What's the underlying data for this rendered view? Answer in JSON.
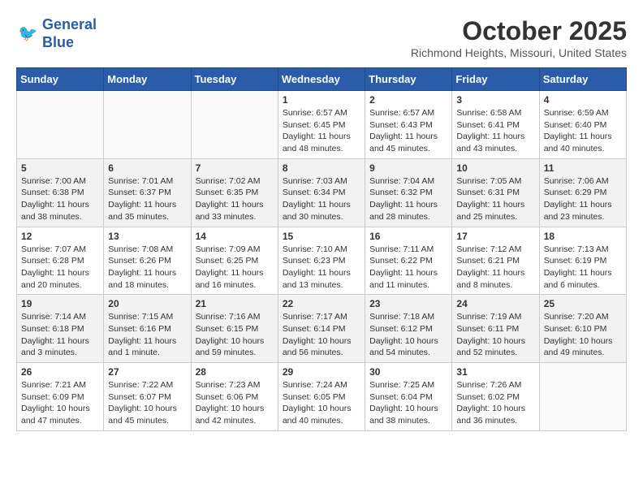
{
  "header": {
    "logo_line1": "General",
    "logo_line2": "Blue",
    "month_year": "October 2025",
    "location": "Richmond Heights, Missouri, United States"
  },
  "days_of_week": [
    "Sunday",
    "Monday",
    "Tuesday",
    "Wednesday",
    "Thursday",
    "Friday",
    "Saturday"
  ],
  "weeks": [
    {
      "shade": "white",
      "days": [
        {
          "num": "",
          "info": ""
        },
        {
          "num": "",
          "info": ""
        },
        {
          "num": "",
          "info": ""
        },
        {
          "num": "1",
          "info": "Sunrise: 6:57 AM\nSunset: 6:45 PM\nDaylight: 11 hours\nand 48 minutes."
        },
        {
          "num": "2",
          "info": "Sunrise: 6:57 AM\nSunset: 6:43 PM\nDaylight: 11 hours\nand 45 minutes."
        },
        {
          "num": "3",
          "info": "Sunrise: 6:58 AM\nSunset: 6:41 PM\nDaylight: 11 hours\nand 43 minutes."
        },
        {
          "num": "4",
          "info": "Sunrise: 6:59 AM\nSunset: 6:40 PM\nDaylight: 11 hours\nand 40 minutes."
        }
      ]
    },
    {
      "shade": "shaded",
      "days": [
        {
          "num": "5",
          "info": "Sunrise: 7:00 AM\nSunset: 6:38 PM\nDaylight: 11 hours\nand 38 minutes."
        },
        {
          "num": "6",
          "info": "Sunrise: 7:01 AM\nSunset: 6:37 PM\nDaylight: 11 hours\nand 35 minutes."
        },
        {
          "num": "7",
          "info": "Sunrise: 7:02 AM\nSunset: 6:35 PM\nDaylight: 11 hours\nand 33 minutes."
        },
        {
          "num": "8",
          "info": "Sunrise: 7:03 AM\nSunset: 6:34 PM\nDaylight: 11 hours\nand 30 minutes."
        },
        {
          "num": "9",
          "info": "Sunrise: 7:04 AM\nSunset: 6:32 PM\nDaylight: 11 hours\nand 28 minutes."
        },
        {
          "num": "10",
          "info": "Sunrise: 7:05 AM\nSunset: 6:31 PM\nDaylight: 11 hours\nand 25 minutes."
        },
        {
          "num": "11",
          "info": "Sunrise: 7:06 AM\nSunset: 6:29 PM\nDaylight: 11 hours\nand 23 minutes."
        }
      ]
    },
    {
      "shade": "white",
      "days": [
        {
          "num": "12",
          "info": "Sunrise: 7:07 AM\nSunset: 6:28 PM\nDaylight: 11 hours\nand 20 minutes."
        },
        {
          "num": "13",
          "info": "Sunrise: 7:08 AM\nSunset: 6:26 PM\nDaylight: 11 hours\nand 18 minutes."
        },
        {
          "num": "14",
          "info": "Sunrise: 7:09 AM\nSunset: 6:25 PM\nDaylight: 11 hours\nand 16 minutes."
        },
        {
          "num": "15",
          "info": "Sunrise: 7:10 AM\nSunset: 6:23 PM\nDaylight: 11 hours\nand 13 minutes."
        },
        {
          "num": "16",
          "info": "Sunrise: 7:11 AM\nSunset: 6:22 PM\nDaylight: 11 hours\nand 11 minutes."
        },
        {
          "num": "17",
          "info": "Sunrise: 7:12 AM\nSunset: 6:21 PM\nDaylight: 11 hours\nand 8 minutes."
        },
        {
          "num": "18",
          "info": "Sunrise: 7:13 AM\nSunset: 6:19 PM\nDaylight: 11 hours\nand 6 minutes."
        }
      ]
    },
    {
      "shade": "shaded",
      "days": [
        {
          "num": "19",
          "info": "Sunrise: 7:14 AM\nSunset: 6:18 PM\nDaylight: 11 hours\nand 3 minutes."
        },
        {
          "num": "20",
          "info": "Sunrise: 7:15 AM\nSunset: 6:16 PM\nDaylight: 11 hours\nand 1 minute."
        },
        {
          "num": "21",
          "info": "Sunrise: 7:16 AM\nSunset: 6:15 PM\nDaylight: 10 hours\nand 59 minutes."
        },
        {
          "num": "22",
          "info": "Sunrise: 7:17 AM\nSunset: 6:14 PM\nDaylight: 10 hours\nand 56 minutes."
        },
        {
          "num": "23",
          "info": "Sunrise: 7:18 AM\nSunset: 6:12 PM\nDaylight: 10 hours\nand 54 minutes."
        },
        {
          "num": "24",
          "info": "Sunrise: 7:19 AM\nSunset: 6:11 PM\nDaylight: 10 hours\nand 52 minutes."
        },
        {
          "num": "25",
          "info": "Sunrise: 7:20 AM\nSunset: 6:10 PM\nDaylight: 10 hours\nand 49 minutes."
        }
      ]
    },
    {
      "shade": "white",
      "days": [
        {
          "num": "26",
          "info": "Sunrise: 7:21 AM\nSunset: 6:09 PM\nDaylight: 10 hours\nand 47 minutes."
        },
        {
          "num": "27",
          "info": "Sunrise: 7:22 AM\nSunset: 6:07 PM\nDaylight: 10 hours\nand 45 minutes."
        },
        {
          "num": "28",
          "info": "Sunrise: 7:23 AM\nSunset: 6:06 PM\nDaylight: 10 hours\nand 42 minutes."
        },
        {
          "num": "29",
          "info": "Sunrise: 7:24 AM\nSunset: 6:05 PM\nDaylight: 10 hours\nand 40 minutes."
        },
        {
          "num": "30",
          "info": "Sunrise: 7:25 AM\nSunset: 6:04 PM\nDaylight: 10 hours\nand 38 minutes."
        },
        {
          "num": "31",
          "info": "Sunrise: 7:26 AM\nSunset: 6:02 PM\nDaylight: 10 hours\nand 36 minutes."
        },
        {
          "num": "",
          "info": ""
        }
      ]
    }
  ]
}
